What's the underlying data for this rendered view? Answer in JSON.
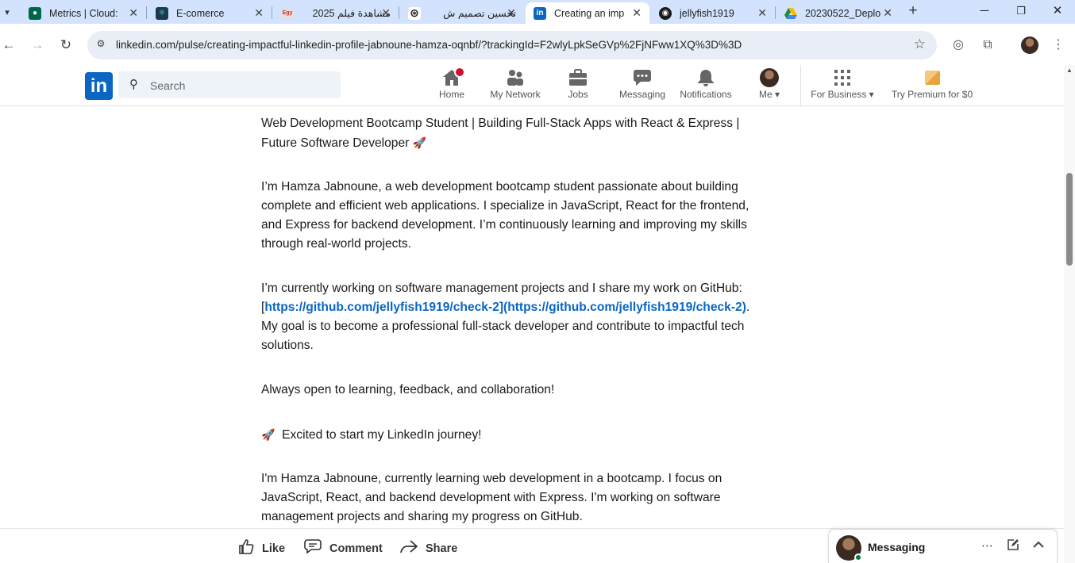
{
  "browser": {
    "tabs": [
      {
        "title": "Metrics | Cloud: ",
        "icon": "mongodb-leaf-icon",
        "color": "#00684a"
      },
      {
        "title": "E-comerce",
        "icon": "react-atom-icon",
        "color": "#1b3a4b"
      },
      {
        "title": "مشاهدة فيلم 2025",
        "icon": "site-favicon-icon",
        "color": "#b0b0b0"
      },
      {
        "title": "تحسين تصميم ش",
        "icon": "chatgpt-icon",
        "color": "#1a1a1a"
      },
      {
        "title": "Creating an imp",
        "icon": "linkedin-icon",
        "color": "#0a66c2"
      },
      {
        "title": "jellyfish1919",
        "icon": "github-icon",
        "color": "#1a1a1a"
      },
      {
        "title": "20230522_Deplo",
        "icon": "google-drive-icon",
        "color": "#1e8e3e"
      }
    ],
    "url": "linkedin.com/pulse/creating-impactful-linkedin-profile-jabnoune-hamza-oqnbf/?trackingId=F2wlyLpkSeGVp%2FjNFww1XQ%3D%3D"
  },
  "linkedin": {
    "logo_text": "in",
    "search_placeholder": "Search",
    "nav": {
      "home": "Home",
      "network": "My Network",
      "jobs": "Jobs",
      "messaging": "Messaging",
      "notifications": "Notifications",
      "me": "Me",
      "business": "For Business",
      "premium": "Try Premium for $0"
    }
  },
  "article": {
    "p1": "Web Development Bootcamp Student | Building Full-Stack Apps with React & Express | Future Software Developer",
    "p1_emoji": "🚀",
    "p2": "I’m Hamza Jabnoune, a web development bootcamp student passionate about building complete and efficient web applications. I specialize in JavaScript, React for the frontend, and Express for backend development. I’m continuously learning and improving my skills through real-world projects.",
    "p3_before": "I’m currently working on software management projects and I share my work on GitHub: [",
    "p3_link": "https://github.com/jellyfish1919/check-2](https://github.com/jellyfish1919/check-2)",
    "p3_after": ". My goal is to become a professional full-stack developer and contribute to impactful tech solutions.",
    "p4": "Always open to learning, feedback, and collaboration!",
    "p5_emoji": "🚀",
    "p5": "Excited to start my LinkedIn journey!",
    "p6": "I'm Hamza Jabnoune, currently learning web development in a bootcamp. I focus on JavaScript, React, and backend development with Express. I'm working on software management projects and sharing my progress on GitHub."
  },
  "actions": {
    "like": "Like",
    "comment": "Comment",
    "share": "Share"
  },
  "messaging_bar": {
    "title": "Messaging"
  },
  "colors": {
    "linkedin_blue": "#0a66c2",
    "tabstrip": "#d3e3fd",
    "notification_badge": "#cb112d"
  }
}
